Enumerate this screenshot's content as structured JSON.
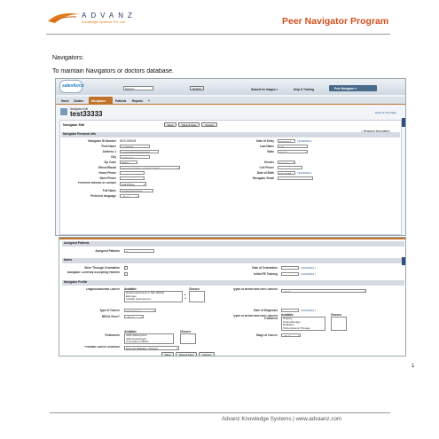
{
  "header": {
    "brand_name": "ADVANZ",
    "brand_tagline": "Knowledge Systems Pvt. Ltd.",
    "program_title": "Peer Navigator Program"
  },
  "intro": {
    "heading": "Navigators:",
    "description": "To maintain Navigators or doctors database."
  },
  "screenshot1": {
    "logo": "salesforce",
    "search_placeholder": "Search...",
    "search_button": "Search",
    "top_links": [
      "Submit for Images ▾",
      "Help & Training"
    ],
    "app_menu": "Peer Navigator ▾",
    "tabs": [
      "Home",
      "Chatter",
      "Navigators",
      "Patients",
      "Reports",
      "+"
    ],
    "active_tab": "Navigators",
    "record_caption": "Navigator Edit",
    "record_title": "test33333",
    "help_link": "Help for this Page",
    "edit_title": "Navigator Edit",
    "buttons": [
      "Save",
      "Save & New",
      "Cancel"
    ],
    "required_note": "= Required Information",
    "section_title": "Navigator Personal Info",
    "left_fields": [
      {
        "label": "Navigator ID Number",
        "value": "NDS-000048"
      },
      {
        "label": "First Name",
        "value": "test33333"
      },
      {
        "label": "Address 1",
        "value": "1000000000000000000"
      },
      {
        "label": "City",
        "value": "Anchorage"
      },
      {
        "label": "Zip Code",
        "value": "99501"
      },
      {
        "label": "Ethnic/Racial",
        "value": "American Indian or Alaska Native"
      },
      {
        "label": "Home Phone",
        "value": ""
      },
      {
        "label": "Work Phone",
        "value": ""
      },
      {
        "label": "Preferred Method of Contact",
        "value": "Cell Phone"
      },
      {
        "label": "Full Name",
        "value": "00000000000000"
      },
      {
        "label": "Preferred language",
        "value": "--None--"
      }
    ],
    "right_fields": [
      {
        "label": "Date of Entry",
        "value": "5/23/2012",
        "link": "[ 5/23/2012 ]"
      },
      {
        "label": "Last Name",
        "value": "123"
      },
      {
        "label": "State",
        "value": "Alaska"
      },
      {
        "label": "Gender",
        "value": "Female"
      },
      {
        "label": "Cell Phone",
        "value": ""
      },
      {
        "label": "Date of Birth",
        "value": "5/21/1958",
        "link": "[ 5/23/2012 ]"
      },
      {
        "label": "Navigator Email",
        "value": ""
      }
    ]
  },
  "screenshot2": {
    "sections": {
      "assigned": "Assigned Patients",
      "notes": "Notes",
      "profile": "Navigator Profile"
    },
    "assigned_label": "Assigned Patients",
    "assigned_value": "0",
    "notes_fields": [
      {
        "label": "Been Through Orientation",
        "right_label": "Date of Orientation",
        "right_link": "[ 5/23/2012 ]"
      },
      {
        "label": "Navigator Currently Accepting Patients",
        "right_label": "Initial PE Training",
        "right_link": "[ 5/23/2012 ]"
      }
    ],
    "profile": {
      "diag_label": "Diagnosis/Breast Cancer",
      "available_label": "Available",
      "chosen_label": "Chosen",
      "diag_options": [
        "Ductal Carcinoma in Situ (DCIS)",
        "Estrogen",
        "Lobular carcinoma In..."
      ],
      "types_breast_label": "Types of Breast and Non Cancers",
      "types_breast_value": "--None--",
      "cancer_type_label": "Type of Cancer",
      "cancer_type_value": "Anal Cancer",
      "date_diag_label": "Date of Diagnosis",
      "date_diag_link": "[ 5/23/2012 ]",
      "brca_label": "BRCA Gene?",
      "brca_value": "--None--",
      "treat_types_label": "Types of Breast and Non Cancers Treatment",
      "treat_options": [
        "Surgery",
        "Chemotherapy",
        "Radiation",
        "Photodynamic Therapy"
      ],
      "stage_label": "Stage of Cancer",
      "stage_value": "--None--",
      "treatments_label": "Treatments",
      "treatments_options": [
        "ACR Adriamycine",
        "AFE Antiestrogen",
        "Aromatase Inhibitor"
      ],
      "prostate_label": "Prostate Cancer Selection",
      "prostate_value": "External Radiation Therapy"
    },
    "buttons": [
      "Save",
      "Save & New",
      "Cancel"
    ]
  },
  "page_number": "1",
  "footer": "Advanz Knowledge Systems | www.advaanz.com"
}
